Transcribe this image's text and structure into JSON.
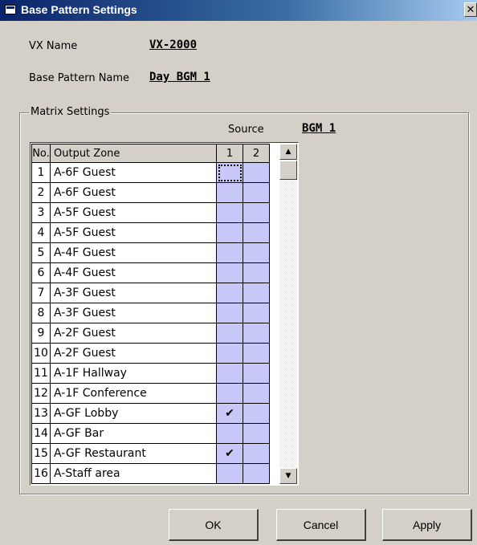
{
  "window": {
    "title": "Base Pattern Settings",
    "close_glyph": "✕"
  },
  "fields": {
    "vx_name_label": "VX Name",
    "vx_name_value": "VX-2000",
    "base_pattern_label": "Base Pattern Name",
    "base_pattern_value": "Day BGM 1"
  },
  "matrix": {
    "group_label": "Matrix Settings",
    "source_label": "Source",
    "source_value": "BGM 1",
    "headers": {
      "no": "No.",
      "zone": "Output Zone",
      "src1": "1",
      "src2": "2"
    },
    "rows": [
      {
        "no": "1",
        "zone": "A-6F Guest",
        "s1": "",
        "s2": ""
      },
      {
        "no": "2",
        "zone": "A-6F Guest",
        "s1": "",
        "s2": ""
      },
      {
        "no": "3",
        "zone": "A-5F Guest",
        "s1": "",
        "s2": ""
      },
      {
        "no": "4",
        "zone": "A-5F Guest",
        "s1": "",
        "s2": ""
      },
      {
        "no": "5",
        "zone": "A-4F Guest",
        "s1": "",
        "s2": ""
      },
      {
        "no": "6",
        "zone": "A-4F Guest",
        "s1": "",
        "s2": ""
      },
      {
        "no": "7",
        "zone": "A-3F Guest",
        "s1": "",
        "s2": ""
      },
      {
        "no": "8",
        "zone": "A-3F Guest",
        "s1": "",
        "s2": ""
      },
      {
        "no": "9",
        "zone": "A-2F Guest",
        "s1": "",
        "s2": ""
      },
      {
        "no": "10",
        "zone": "A-2F Guest",
        "s1": "",
        "s2": ""
      },
      {
        "no": "11",
        "zone": "A-1F Hallway",
        "s1": "",
        "s2": ""
      },
      {
        "no": "12",
        "zone": "A-1F Conference",
        "s1": "",
        "s2": ""
      },
      {
        "no": "13",
        "zone": "A-GF Lobby",
        "s1": "✔",
        "s2": ""
      },
      {
        "no": "14",
        "zone": "A-GF Bar",
        "s1": "",
        "s2": ""
      },
      {
        "no": "15",
        "zone": "A-GF Restaurant",
        "s1": "✔",
        "s2": ""
      },
      {
        "no": "16",
        "zone": "A-Staff area",
        "s1": "",
        "s2": ""
      }
    ]
  },
  "scrollbar": {
    "up_glyph": "▲",
    "down_glyph": "▼"
  },
  "buttons": {
    "ok": "OK",
    "cancel": "Cancel",
    "apply": "Apply"
  }
}
